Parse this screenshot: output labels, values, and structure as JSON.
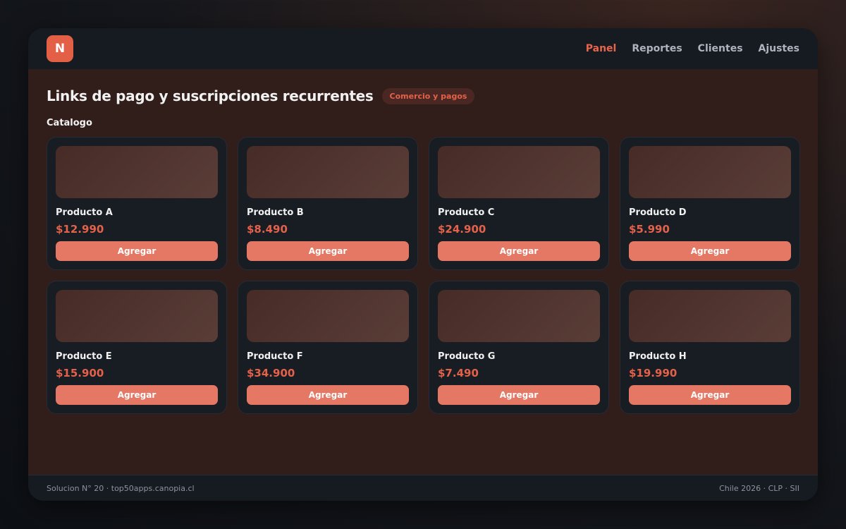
{
  "app": {
    "logo_letter": "N",
    "nav": [
      {
        "label": "Panel",
        "active": true
      },
      {
        "label": "Reportes",
        "active": false
      },
      {
        "label": "Clientes",
        "active": false
      },
      {
        "label": "Ajustes",
        "active": false
      }
    ]
  },
  "page": {
    "title": "Links de pago y suscripciones recurrentes",
    "badge": "Comercio y pagos",
    "section_label": "Catalogo"
  },
  "products": [
    {
      "name": "Producto A",
      "price": "$12.990",
      "button": "Agregar"
    },
    {
      "name": "Producto B",
      "price": "$8.490",
      "button": "Agregar"
    },
    {
      "name": "Producto C",
      "price": "$24.900",
      "button": "Agregar"
    },
    {
      "name": "Producto D",
      "price": "$5.990",
      "button": "Agregar"
    },
    {
      "name": "Producto E",
      "price": "$15.900",
      "button": "Agregar"
    },
    {
      "name": "Producto F",
      "price": "$34.900",
      "button": "Agregar"
    },
    {
      "name": "Producto G",
      "price": "$7.490",
      "button": "Agregar"
    },
    {
      "name": "Producto H",
      "price": "$19.990",
      "button": "Agregar"
    }
  ],
  "footer": {
    "left": "Solucion N° 20 · top50apps.canopia.cl",
    "right": "Chile 2026 · CLP · SII"
  },
  "colors": {
    "accent": "#e35f45",
    "button": "#e47864",
    "background": "#311e1b",
    "card": "#181c23"
  }
}
